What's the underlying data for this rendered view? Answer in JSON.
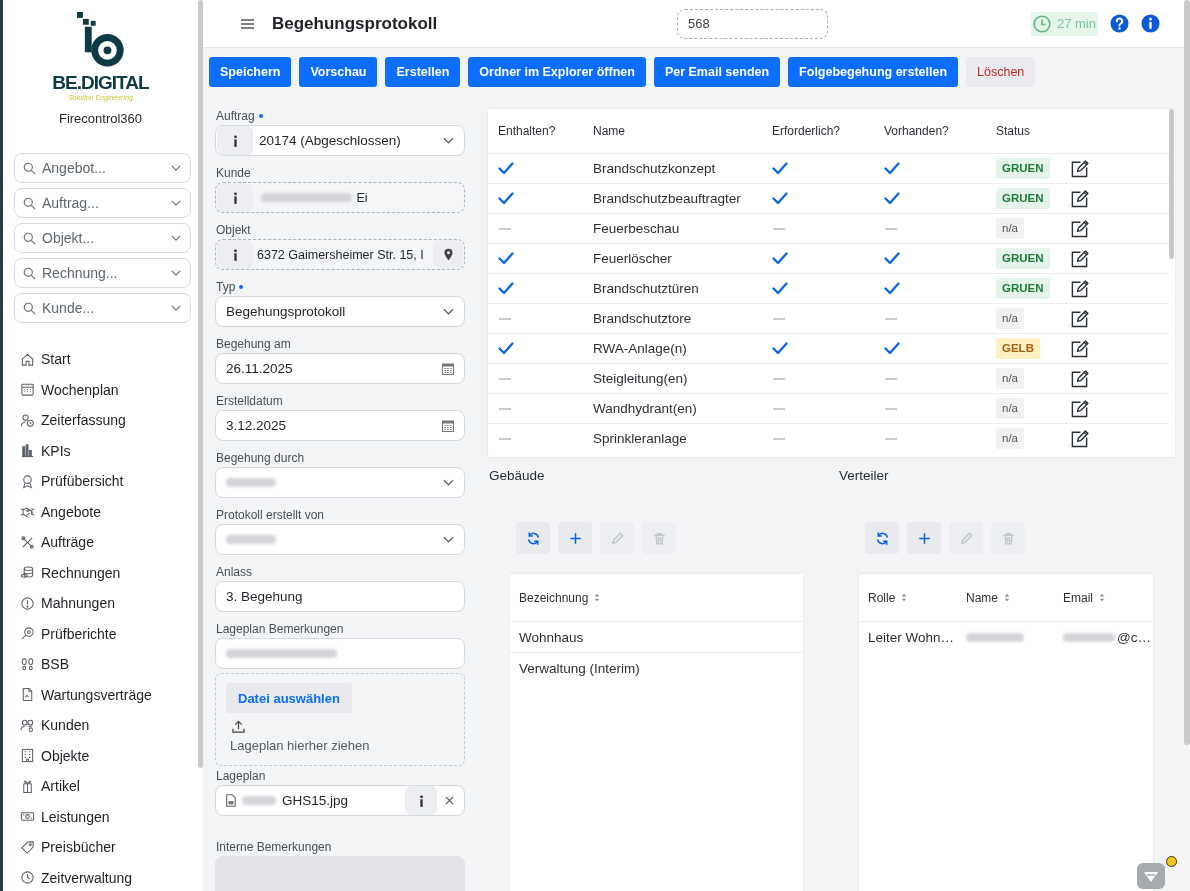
{
  "sidebar": {
    "logo": {
      "name": "BE.DIGITAL",
      "tagline": "Solution Engineering"
    },
    "app_name": "Firecontrol360",
    "search_fields": [
      {
        "placeholder": "Angebot..."
      },
      {
        "placeholder": "Auftrag..."
      },
      {
        "placeholder": "Objekt..."
      },
      {
        "placeholder": "Rechnung..."
      },
      {
        "placeholder": "Kunde..."
      }
    ],
    "nav_items": [
      {
        "label": "Start"
      },
      {
        "label": "Wochenplan"
      },
      {
        "label": "Zeiterfassung"
      },
      {
        "label": "KPIs"
      },
      {
        "label": "Prüfübersicht"
      },
      {
        "label": "Angebote"
      },
      {
        "label": "Aufträge"
      },
      {
        "label": "Rechnungen"
      },
      {
        "label": "Mahnungen"
      },
      {
        "label": "Prüfberichte"
      },
      {
        "label": "BSB"
      },
      {
        "label": "Wartungsverträge"
      },
      {
        "label": "Kunden"
      },
      {
        "label": "Objekte"
      },
      {
        "label": "Artikel"
      },
      {
        "label": "Leistungen"
      },
      {
        "label": "Preisbücher"
      },
      {
        "label": "Zeitverwaltung"
      }
    ]
  },
  "header": {
    "title": "Begehungsprotokoll",
    "search": {
      "value": "568"
    },
    "timer": "27 min"
  },
  "toolbar": {
    "buttons": [
      {
        "label": "Speichern",
        "kind": "primary"
      },
      {
        "label": "Vorschau",
        "kind": "primary"
      },
      {
        "label": "Erstellen",
        "kind": "primary"
      },
      {
        "label": "Ordner im Explorer öffnen",
        "kind": "primary"
      },
      {
        "label": "Per Email senden",
        "kind": "primary"
      },
      {
        "label": "Folgebegehung erstellen",
        "kind": "primary"
      },
      {
        "label": "Löschen",
        "kind": "danger"
      }
    ]
  },
  "form": {
    "fields": [
      {
        "kind": "select",
        "label": "Auftrag",
        "required": true,
        "info_button": true,
        "value": "20174 (Abgeschlossen)"
      },
      {
        "kind": "readonly",
        "label": "Kunde",
        "required": false,
        "info_button": true,
        "blurred": true,
        "value": "Ei"
      },
      {
        "kind": "readonly",
        "label": "Objekt",
        "required": false,
        "info_button": true,
        "map_button": true,
        "value": "6372 Gaimersheimer Str. 15, I"
      },
      {
        "kind": "select",
        "label": "Typ",
        "required": true,
        "value": "Begehungsprotokoll"
      },
      {
        "kind": "date",
        "label": "Begehung am",
        "required": false,
        "value": "26.11.2025"
      },
      {
        "kind": "date",
        "label": "Erstelldatum",
        "required": false,
        "value": "3.12.2025"
      },
      {
        "kind": "select",
        "label": "Begehung durch",
        "required": false,
        "blurred": true
      },
      {
        "kind": "select",
        "label": "Protokoll erstellt von",
        "required": false,
        "blurred": true
      },
      {
        "kind": "text",
        "label": "Anlass",
        "required": false,
        "value": "3. Begehung"
      },
      {
        "kind": "text",
        "label": "Lageplan Bemerkungen",
        "required": false,
        "blurred": true
      },
      {
        "kind": "dropzone",
        "button": "Datei auswählen",
        "hint": "Lageplan hierher ziehen"
      },
      {
        "kind": "file",
        "label": "Lageplan",
        "required": false,
        "info_button": true,
        "blurred": true,
        "value": "GHS15.jpg"
      },
      {
        "kind": "textarea",
        "label": "Interne Bemerkungen",
        "required": false
      }
    ]
  },
  "checklist": {
    "columns": [
      "Enthalten?",
      "Name",
      "Erforderlich?",
      "Vorhanden?",
      "Status"
    ],
    "rows": [
      {
        "included": true,
        "name": "Brandschutzkonzept",
        "required": true,
        "present": true,
        "status": {
          "label": "GRUEN",
          "kind": "success"
        }
      },
      {
        "included": true,
        "name": "Brandschutzbeauftragter",
        "required": true,
        "present": true,
        "status": {
          "label": "GRUEN",
          "kind": "success"
        }
      },
      {
        "included": false,
        "name": "Feuerbeschau",
        "required": false,
        "present": false,
        "status": {
          "label": "n/a",
          "kind": "neutral"
        }
      },
      {
        "included": true,
        "name": "Feuerlöscher",
        "required": true,
        "present": true,
        "status": {
          "label": "GRUEN",
          "kind": "success"
        }
      },
      {
        "included": true,
        "name": "Brandschutztüren",
        "required": true,
        "present": true,
        "status": {
          "label": "GRUEN",
          "kind": "success"
        }
      },
      {
        "included": false,
        "name": "Brandschutztore",
        "required": false,
        "present": false,
        "status": {
          "label": "n/a",
          "kind": "neutral"
        }
      },
      {
        "included": true,
        "name": "RWA-Anlage(n)",
        "required": true,
        "present": true,
        "status": {
          "label": "GELB",
          "kind": "warning"
        }
      },
      {
        "included": false,
        "name": "Steigleitung(en)",
        "required": false,
        "present": false,
        "status": {
          "label": "n/a",
          "kind": "neutral"
        }
      },
      {
        "included": false,
        "name": "Wandhydrant(en)",
        "required": false,
        "present": false,
        "status": {
          "label": "n/a",
          "kind": "neutral"
        }
      },
      {
        "included": false,
        "name": "Sprinkleranlage",
        "required": false,
        "present": false,
        "status": {
          "label": "n/a",
          "kind": "neutral"
        }
      }
    ]
  },
  "buildings": {
    "title": "Gebäude",
    "actions": [
      {
        "disabled": false
      },
      {
        "disabled": false
      },
      {
        "disabled": true
      },
      {
        "disabled": true
      }
    ],
    "columns": [
      "Bezeichnung"
    ],
    "rows": [
      {
        "cells": [
          {
            "text": "Wohnhaus"
          }
        ]
      },
      {
        "cells": [
          {
            "text": "Verwaltung (Interim)"
          }
        ]
      }
    ]
  },
  "distribution": {
    "title": "Verteiler",
    "actions": [
      {
        "disabled": false
      },
      {
        "disabled": false
      },
      {
        "disabled": true
      },
      {
        "disabled": true
      }
    ],
    "columns": [
      "Rolle",
      "Name",
      "Email"
    ],
    "rows": [
      {
        "cells": [
          {
            "text": "Leiter Wohn…"
          },
          {
            "blurred": true
          },
          {
            "blurred": true,
            "text": "@c…"
          }
        ]
      }
    ]
  },
  "help_widget": {
    "notification": true
  }
}
